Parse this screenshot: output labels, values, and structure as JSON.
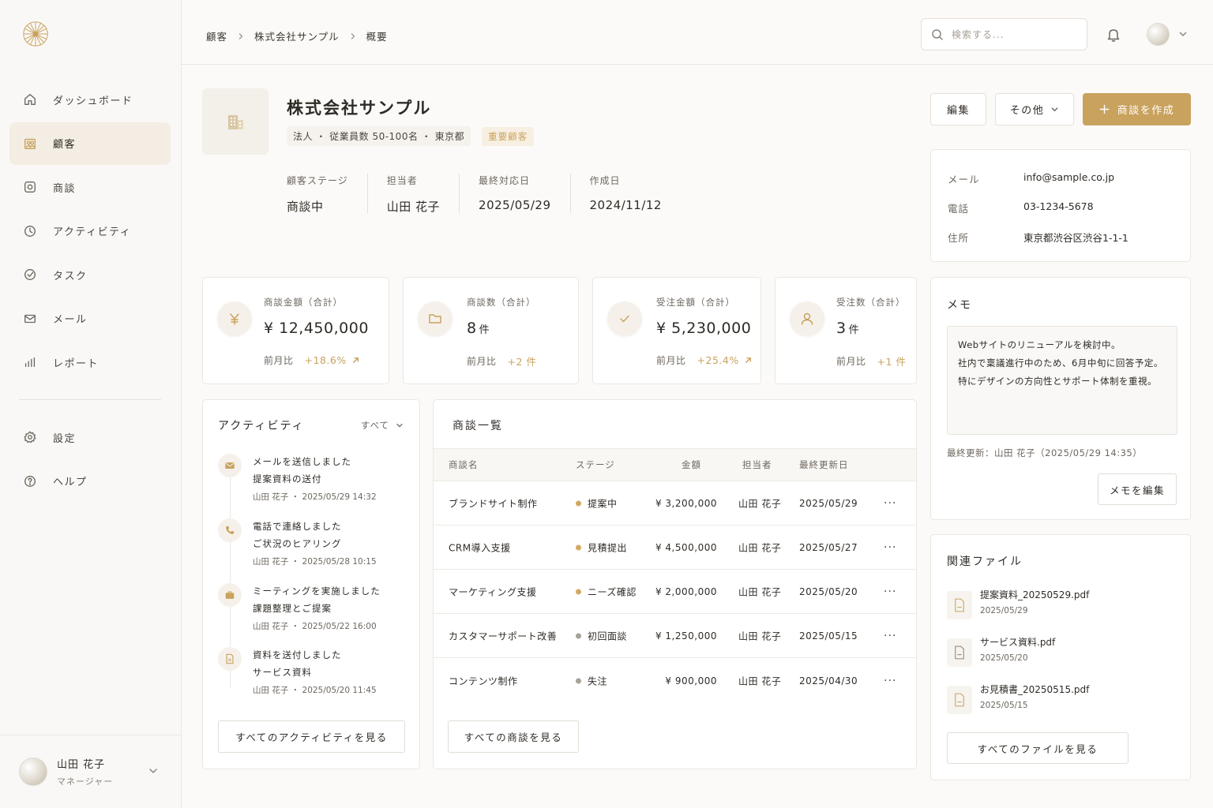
{
  "breadcrumb": [
    "顧客",
    "株式会社サンプル",
    "概要"
  ],
  "search": {
    "placeholder": "検索する..."
  },
  "sidebar": {
    "items": [
      {
        "label": "ダッシュボード",
        "icon": "home-icon"
      },
      {
        "label": "顧客",
        "icon": "customers-icon",
        "active": true
      },
      {
        "label": "商談",
        "icon": "deals-icon"
      },
      {
        "label": "アクティビティ",
        "icon": "clock-icon"
      },
      {
        "label": "タスク",
        "icon": "check-circle-icon"
      },
      {
        "label": "メール",
        "icon": "mail-icon"
      },
      {
        "label": "レポート",
        "icon": "bar-chart-icon"
      }
    ],
    "secondary": [
      {
        "label": "設定",
        "icon": "gear-icon"
      },
      {
        "label": "ヘルプ",
        "icon": "help-icon"
      }
    ],
    "user": {
      "name": "山田 花子",
      "role": "マネージャー"
    }
  },
  "company": {
    "name": "株式会社サンプル",
    "meta": "法人 ・ 従業員数 50-100名 ・ 東京都",
    "tag": "重要顧客",
    "stats": [
      {
        "label": "顧客ステージ",
        "value": "商談中"
      },
      {
        "label": "担当者",
        "value": "山田 花子"
      },
      {
        "label": "最終対応日",
        "value": "2025/05/29"
      },
      {
        "label": "作成日",
        "value": "2024/11/12"
      }
    ]
  },
  "actions": {
    "edit": "編集",
    "more": "その他",
    "create": "商談を作成"
  },
  "contact": [
    {
      "label": "メール",
      "value": "info@sample.co.jp"
    },
    {
      "label": "電話",
      "value": "03-1234-5678"
    },
    {
      "label": "住所",
      "value": "東京都渋谷区渋谷1-1-1"
    }
  ],
  "kpis": [
    {
      "label": "商談金額（合計）",
      "value": "¥ 12,450,000",
      "unit": "",
      "compare": "前月比",
      "change": "+18.6%",
      "icon": "yen-icon"
    },
    {
      "label": "商談数（合計）",
      "value": "8",
      "unit": "件",
      "compare": "前月比",
      "change": "+2 件",
      "icon": "folder-icon"
    },
    {
      "label": "受注金額（合計）",
      "value": "¥ 5,230,000",
      "unit": "",
      "compare": "前月比",
      "change": "+25.4%",
      "icon": "check-icon"
    },
    {
      "label": "受注数（合計）",
      "value": "3",
      "unit": "件",
      "compare": "前月比",
      "change": "+1 件",
      "icon": "user-icon"
    }
  ],
  "activity": {
    "title": "アクティビティ",
    "filter": "すべて",
    "items": [
      {
        "title": "メールを送信しました",
        "sub": "提案資料の送付",
        "meta": "山田 花子 ・ 2025/05/29 14:32",
        "icon": "mail-icon"
      },
      {
        "title": "電話で連絡しました",
        "sub": "ご状況のヒアリング",
        "meta": "山田 花子 ・ 2025/05/28 10:15",
        "icon": "phone-icon"
      },
      {
        "title": "ミーティングを実施しました",
        "sub": "課題整理とご提案",
        "meta": "山田 花子 ・ 2025/05/22 16:00",
        "icon": "briefcase-icon"
      },
      {
        "title": "資料を送付しました",
        "sub": "サービス資料",
        "meta": "山田 花子 ・ 2025/05/20 11:45",
        "icon": "document-icon"
      }
    ],
    "button": "すべてのアクティビティを見る"
  },
  "deals": {
    "title": "商談一覧",
    "columns": [
      "商談名",
      "ステージ",
      "金額",
      "担当者",
      "最終更新日"
    ],
    "rows": [
      {
        "name": "ブランドサイト制作",
        "stage": "提案中",
        "stage_color": "#d3a961",
        "amount": "¥ 3,200,000",
        "owner": "山田 花子",
        "date": "2025/05/29"
      },
      {
        "name": "CRM導入支援",
        "stage": "見積提出",
        "stage_color": "#d3a961",
        "amount": "¥ 4,500,000",
        "owner": "山田 花子",
        "date": "2025/05/27"
      },
      {
        "name": "マーケティング支援",
        "stage": "ニーズ確認",
        "stage_color": "#d3a961",
        "amount": "¥ 2,000,000",
        "owner": "山田 花子",
        "date": "2025/05/20"
      },
      {
        "name": "カスタマーサポート改善",
        "stage": "初回面談",
        "stage_color": "#a8a29a",
        "amount": "¥ 1,250,000",
        "owner": "山田 花子",
        "date": "2025/05/15"
      },
      {
        "name": "コンテンツ制作",
        "stage": "失注",
        "stage_color": "#a8a29a",
        "amount": "¥ 900,000",
        "owner": "山田 花子",
        "date": "2025/04/30"
      }
    ],
    "more_label": "···",
    "button": "すべての商談を見る"
  },
  "memo": {
    "title": "メモ",
    "lines": [
      "Webサイトのリニューアルを検討中。",
      "社内で稟議進行中のため、6月中旬に回答予定。",
      "特にデザインの方向性とサポート体制を重視。"
    ],
    "updated": "最終更新：山田 花子（2025/05/29 14:35）",
    "button": "メモを編集"
  },
  "files": {
    "title": "関連ファイル",
    "items": [
      {
        "name": "提案資料_20250529.pdf",
        "date": "2025/05/29",
        "icon": "pdf-file-icon",
        "color": "#c9a25e"
      },
      {
        "name": "サービス資料.pdf",
        "date": "2025/05/20",
        "icon": "pdf-file-icon",
        "color": "#8b857c"
      },
      {
        "name": "お見積書_20250515.pdf",
        "date": "2025/05/15",
        "icon": "pdf-file-icon",
        "color": "#c9a25e"
      }
    ],
    "button": "すべてのファイルを見る"
  },
  "colors": {
    "accent": "#c9a25e",
    "background": "#fbfaf8",
    "text": "#2f2b26"
  }
}
